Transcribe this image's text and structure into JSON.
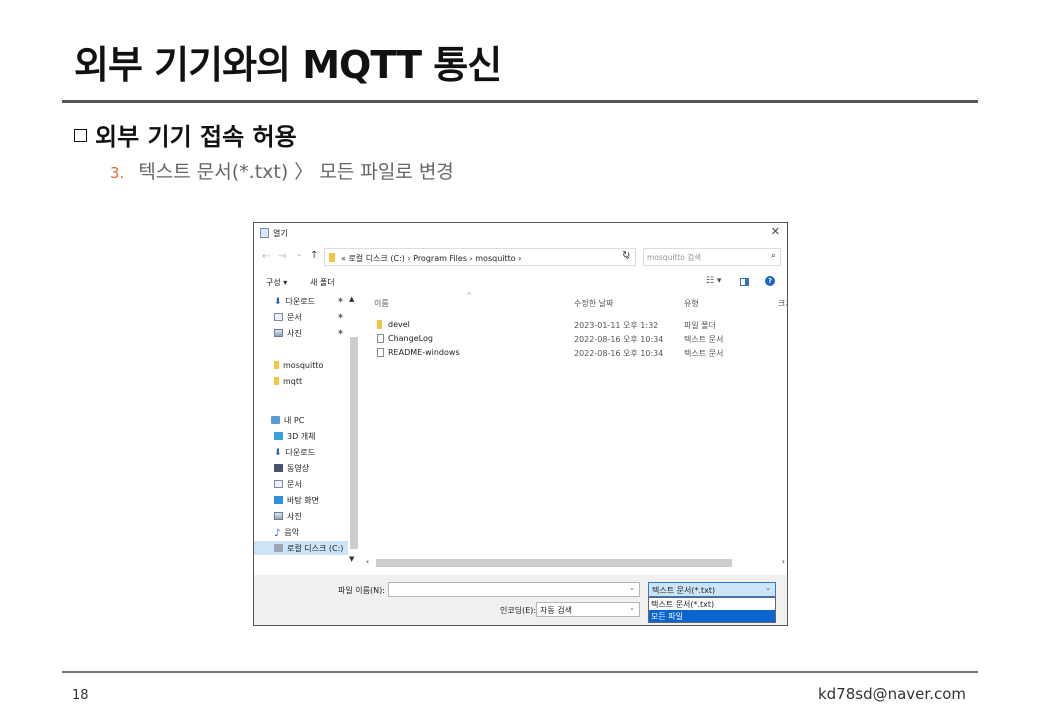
{
  "slide": {
    "title": "외부 기기와의 MQTT 통신",
    "section": "외부 기기 접속 허용",
    "step_number": "3.",
    "step_text": "텍스트 문서(*.txt) 〉 모든 파일로 변경",
    "page_number": "18",
    "email": "kd78sd@naver.com"
  },
  "dialog": {
    "title": "열기",
    "close_glyph": "✕",
    "nav": {
      "back": "←",
      "forward": "→",
      "recent": "⌄",
      "up": "↑",
      "address": "«  로컬 디스크 (C:)  ›  Program Files  ›  mosquitto  ›",
      "refresh": "↻",
      "search_placeholder": "mosquitto 검색",
      "search_glyph": "⌕"
    },
    "commands": {
      "organize": "구성 ▾",
      "new_folder": "새 폴더",
      "view": "☷ ▾",
      "help": "?"
    },
    "sidebar": {
      "quick": [
        {
          "label": "다운로드",
          "icon": "download-icon",
          "pinned": "📌"
        },
        {
          "label": "문서",
          "icon": "document-icon",
          "pinned": "📌"
        },
        {
          "label": "사진",
          "icon": "picture-icon",
          "pinned": "📌"
        },
        {
          "label": "mosquitto",
          "icon": "folder-icon"
        },
        {
          "label": "mqtt",
          "icon": "folder-icon"
        }
      ],
      "this_pc": "내 PC",
      "pc_items": [
        {
          "label": "3D 개체",
          "icon": "3d-objects-icon"
        },
        {
          "label": "다운로드",
          "icon": "download-icon"
        },
        {
          "label": "동영상",
          "icon": "video-icon"
        },
        {
          "label": "문서",
          "icon": "document-icon"
        },
        {
          "label": "바탕 화면",
          "icon": "desktop-icon"
        },
        {
          "label": "사진",
          "icon": "picture-icon"
        },
        {
          "label": "음악",
          "icon": "music-icon"
        },
        {
          "label": "로컬 디스크 (C:)",
          "icon": "drive-icon"
        }
      ]
    },
    "columns": {
      "name": "이름",
      "date": "수정한 날짜",
      "type": "유형",
      "size": "크기"
    },
    "files": [
      {
        "name": "devel",
        "date": "2023-01-11 오후 1:32",
        "type": "파일 폴더",
        "kind": "folder"
      },
      {
        "name": "ChangeLog",
        "date": "2022-08-16 오후 10:34",
        "type": "텍스트 문서",
        "kind": "file"
      },
      {
        "name": "README-windows",
        "date": "2022-08-16 오후 10:34",
        "type": "텍스트 문서",
        "kind": "file"
      }
    ],
    "bottom": {
      "filename_label": "파일 이름(N):",
      "filename_value": "",
      "filetype_selected": "텍스트 문서(*.txt)",
      "filetype_options": [
        "텍스트 문서(*.txt)",
        "모든 파일"
      ],
      "filetype_highlighted": "모든 파일",
      "encoding_label": "인코딩(E):",
      "encoding_value": "자동 검색"
    },
    "colors": {
      "accent": "#0a64d2",
      "selection": "#cce4f7",
      "folder": "#f4c542"
    }
  }
}
